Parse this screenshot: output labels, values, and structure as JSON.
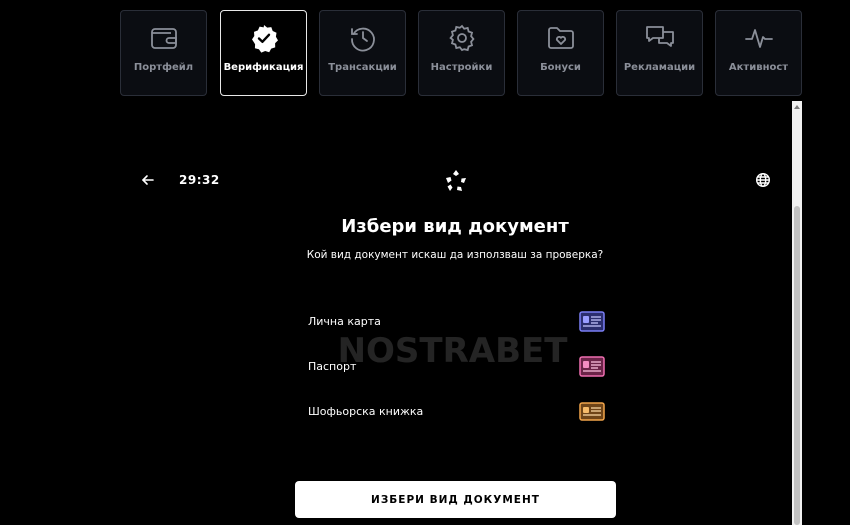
{
  "tabs": [
    {
      "label": "Портфейл",
      "icon": "wallet-icon",
      "active": false
    },
    {
      "label": "Верификация",
      "icon": "verified-badge-icon",
      "active": true
    },
    {
      "label": "Трансакции",
      "icon": "history-icon",
      "active": false
    },
    {
      "label": "Настройки",
      "icon": "gear-icon",
      "active": false
    },
    {
      "label": "Бонуси",
      "icon": "folder-heart-icon",
      "active": false
    },
    {
      "label": "Рекламации",
      "icon": "chat-bubbles-icon",
      "active": false
    },
    {
      "label": "Активност",
      "icon": "activity-pulse-icon",
      "active": false
    }
  ],
  "verification": {
    "timer": "29:32",
    "title": "Избери вид документ",
    "subtitle": "Кой вид документ искаш да използваш за проверка?",
    "documents": [
      {
        "label": "Лична карта",
        "icon": "id-card-icon",
        "color": "#7b7ff5"
      },
      {
        "label": "Паспорт",
        "icon": "passport-icon",
        "color": "#ef6fb1"
      },
      {
        "label": "Шофьорска книжка",
        "icon": "driver-license-icon",
        "color": "#f2a54a"
      }
    ],
    "cta_label": "ИЗБЕРИ ВИД ДОКУМЕНТ"
  },
  "watermark": "NOSTRABET"
}
